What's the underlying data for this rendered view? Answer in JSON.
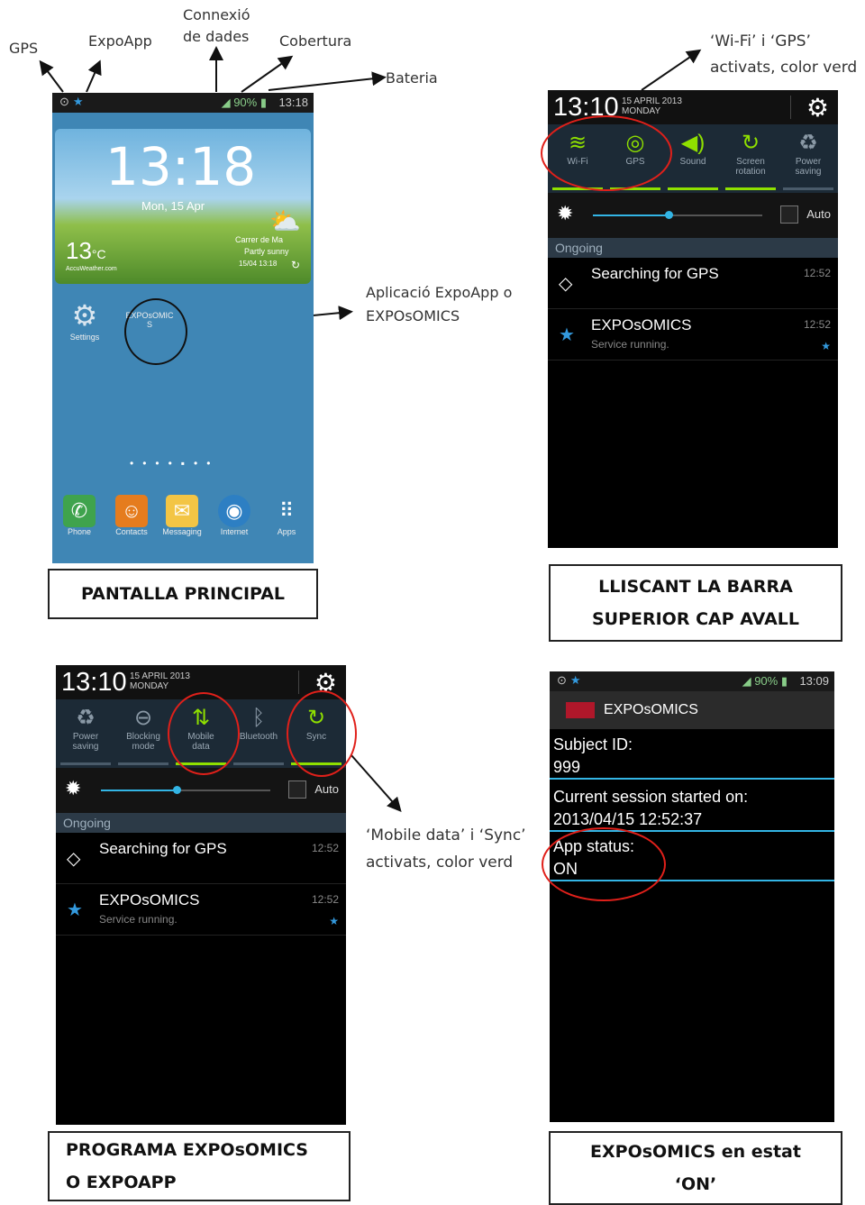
{
  "annotations": {
    "gps": "GPS",
    "expoapp": "ExpoApp",
    "connexio": "Connexió\nde dades",
    "cobertura": "Cobertura",
    "bateria": "Bateria",
    "app_expoapp": "Aplicació ExpoApp o\nEXPOsOMICS",
    "wifi_gps": "‘Wi-Fi’ i ‘GPS’\nactivats, color verd",
    "mobile_sync": "‘Mobile data’ i ‘Sync’\nactivats, color verd"
  },
  "captions": {
    "home": "PANTALLA  PRINCIPAL",
    "swipe": "LLISCANT LA BARRA\nSUPERIOR CAP AVALL",
    "program": "PROGRAMA EXPOsOMICS\nO EXPOAPP",
    "status": "EXPOsOMICS en estat\n‘ON’"
  },
  "home": {
    "status_time": "13:18",
    "status_battery": "90%",
    "clock": "13:18",
    "date": "Mon, 15 Apr",
    "temp": "13",
    "temp_unit": "°C",
    "weather_location": "Carrer de Ma",
    "weather_desc": "Partly sunny",
    "weather_updated": "15/04 13:18",
    "weather_brand": "AccuWeather.com",
    "settings_label": "Settings",
    "expo_icon_label": "EXPOsOMIC\nS",
    "dock": [
      "Phone",
      "Contacts",
      "Messaging",
      "Internet",
      "Apps"
    ]
  },
  "shade_top": {
    "time": "13:10",
    "date_line1": "15 APRIL 2013",
    "date_line2": "MONDAY",
    "tiles": [
      {
        "label": "Wi-Fi",
        "icon": "wifi-icon",
        "on": true
      },
      {
        "label": "GPS",
        "icon": "gps-icon",
        "on": true
      },
      {
        "label": "Sound",
        "icon": "sound-icon",
        "on": true
      },
      {
        "label": "Screen\nrotation",
        "icon": "rotation-icon",
        "on": true
      },
      {
        "label": "Power\nsaving",
        "icon": "recycle-icon",
        "on": false
      }
    ],
    "auto": "Auto",
    "brightness_level": 0.45,
    "ongoing": "Ongoing",
    "notifications": [
      {
        "title": "Searching for GPS",
        "subtitle": "",
        "time": "12:52",
        "icon": "gps-icon"
      },
      {
        "title": "EXPOsOMICS",
        "subtitle": "Service running.",
        "time": "12:52",
        "icon": "star-icon"
      }
    ]
  },
  "shade_bottom": {
    "time": "13:10",
    "date_line1": "15 APRIL 2013",
    "date_line2": "MONDAY",
    "tiles": [
      {
        "label": "Power\nsaving",
        "icon": "recycle-icon",
        "on": false
      },
      {
        "label": "Blocking\nmode",
        "icon": "blocking-icon",
        "on": false
      },
      {
        "label": "Mobile\ndata",
        "icon": "mobile-data-icon",
        "on": true
      },
      {
        "label": "Bluetooth",
        "icon": "bluetooth-icon",
        "on": false
      },
      {
        "label": "Sync",
        "icon": "sync-icon",
        "on": true
      }
    ],
    "auto": "Auto",
    "brightness_level": 0.45,
    "ongoing": "Ongoing",
    "notifications": [
      {
        "title": "Searching for GPS",
        "subtitle": "",
        "time": "12:52",
        "icon": "gps-icon"
      },
      {
        "title": "EXPOsOMICS",
        "subtitle": "Service running.",
        "time": "12:52",
        "icon": "star-icon"
      }
    ]
  },
  "app_screen": {
    "status_time": "13:09",
    "status_battery": "90%",
    "title": "EXPOsOMICS",
    "subject_label": "Subject ID:",
    "subject_value": "999",
    "session_label": "Current session started on:",
    "session_value": "2013/04/15 12:52:37",
    "status_label": "App status:",
    "status_value": "ON"
  },
  "colors": {
    "accent_green": "#8fe000",
    "holo_blue": "#33b5e5",
    "red_circle": "#e0201a"
  }
}
